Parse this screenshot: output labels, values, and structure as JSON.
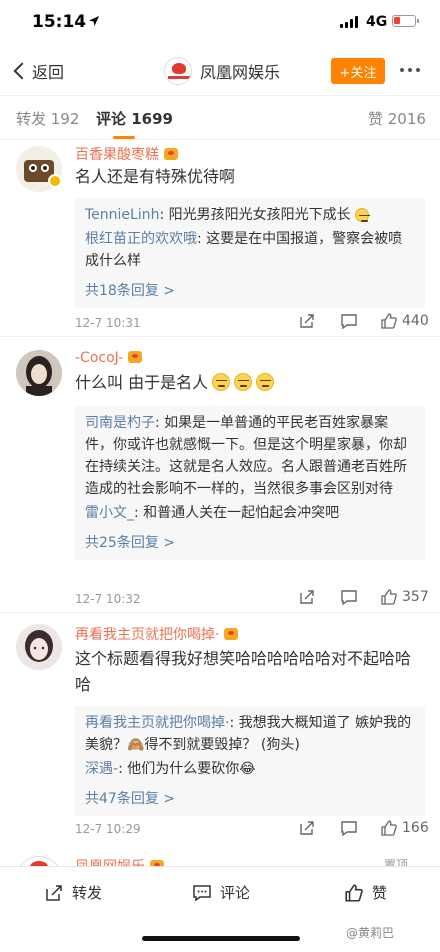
{
  "status_bar": {
    "time": "15:14",
    "network": "4G"
  },
  "nav": {
    "back_label": "返回",
    "title": "凤凰网娱乐",
    "follow_label": "+关注"
  },
  "tabs": [
    {
      "label": "转发 192"
    },
    {
      "label": "评论 1699"
    },
    {
      "label": "赞 2016"
    }
  ],
  "comments": [
    {
      "username": "百香果酸枣糕",
      "text": "名人还是有特殊优待啊",
      "replies": [
        {
          "user": "TennieLinh",
          "text": ": 阳光男孩阳光女孩阳光下成长"
        },
        {
          "user": "根红苗正的欢欢哦",
          "text": ": 这要是在中国报道，警察会被喷成什么样"
        }
      ],
      "more_replies": "共18条回复 >",
      "time": "12-7 10:31",
      "likes": "440"
    },
    {
      "username": "-CocoJ-",
      "text": "什么叫 由于是名人",
      "replies": [
        {
          "user": "司南是杓子",
          "text": ": 如果是一单普通的平民老百姓家暴案件，你或许也就感慨一下。但是这个明星家暴，你却在持续关注。这就是名人效应。名人跟普通老百姓所造成的社会影响不一样的，当然很多事会区别对待"
        },
        {
          "user": "雷小文_",
          "text": ": 和普通人关在一起怕起会冲突吧"
        }
      ],
      "more_replies": "共25条回复 >",
      "time": "12-7 10:32",
      "likes": "357"
    },
    {
      "username": "再看我主页就把你喝掉·",
      "text": "这个标题看得我好想笑哈哈哈哈哈哈对不起哈哈哈",
      "replies": [
        {
          "user": "再看我主页就把你喝掉·",
          "text": ": 我想我大概知道了 嫉妒我的美貌？🙈得不到就要毁掉？ (狗头)"
        },
        {
          "user": "深遇-",
          "text": ": 他们为什么要砍你😂"
        }
      ],
      "more_replies": "共47条回复 >",
      "time": "12-7 10:29",
      "likes": "166"
    },
    {
      "username": "凤凰网娱乐",
      "tag": "置顶"
    }
  ],
  "bottom_bar": {
    "repost": "转发",
    "comment": "评论",
    "like": "赞"
  },
  "watermark": "@黄莉巴"
}
